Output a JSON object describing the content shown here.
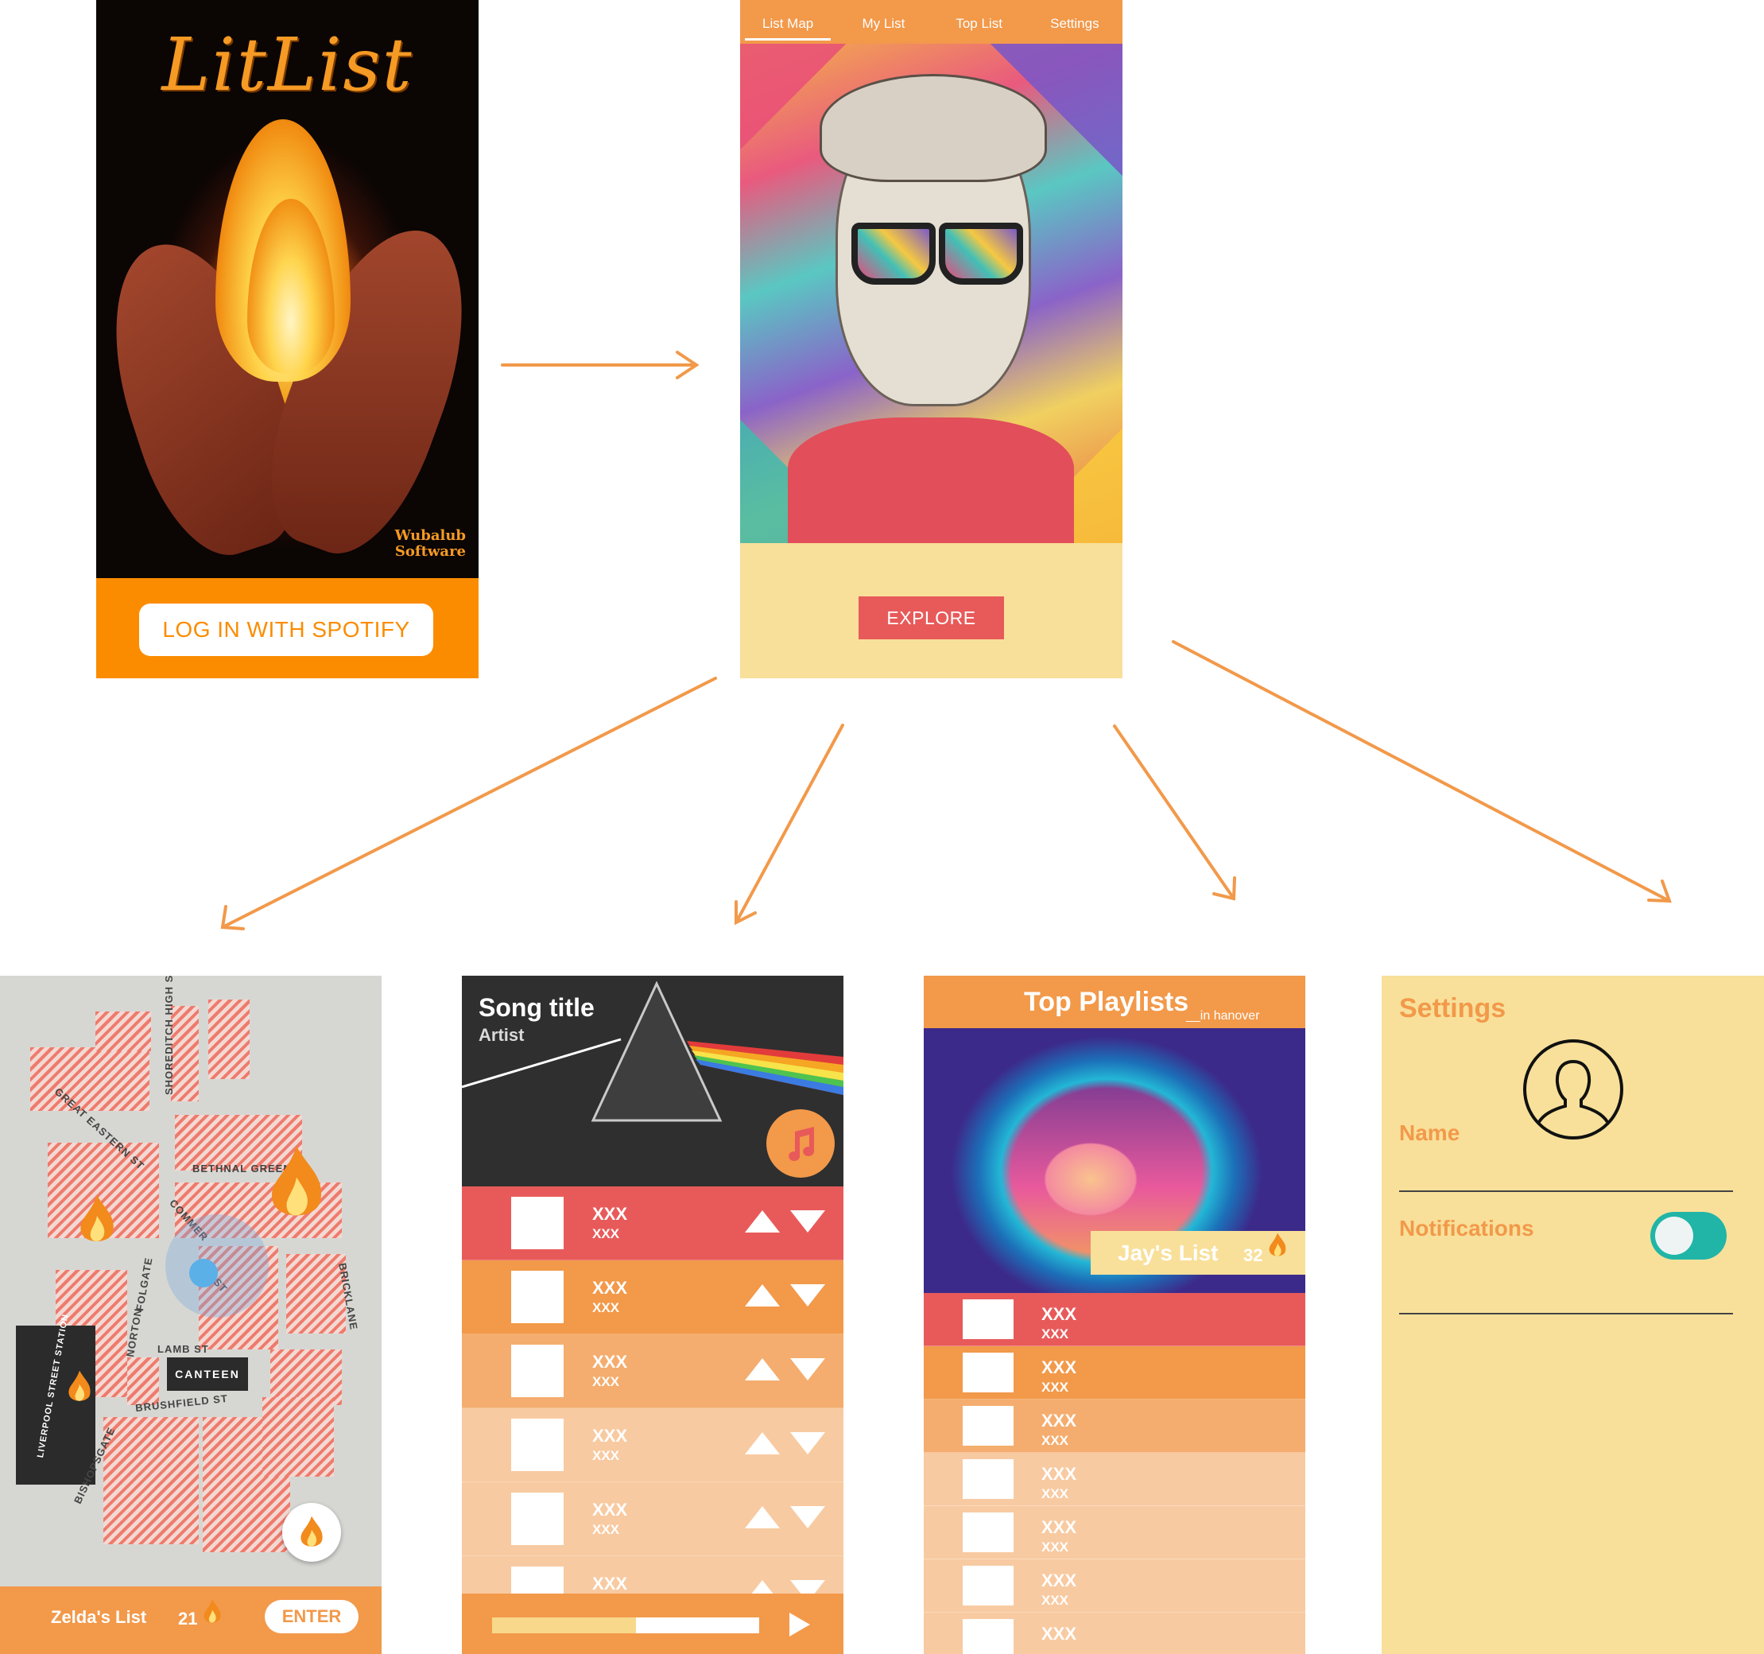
{
  "login": {
    "app_name": "LitList",
    "maker_line1": "Wubalub",
    "maker_line2": "Software",
    "login_button": "LOG IN WITH SPOTIFY"
  },
  "home": {
    "tabs": [
      "List Map",
      "My List",
      "Top List",
      "Settings"
    ],
    "explore_button": "EXPLORE"
  },
  "map": {
    "streets": [
      "SHOREDITCH HIGH ST",
      "GREAT EASTERN ST",
      "BETHNAL GREEN",
      "COMMER",
      "ST",
      "FOLGATE",
      "NORTON",
      "BRICKLANE",
      "LAMB ST",
      "BRUSHFIELD ST",
      "BISHOPSGATE",
      "LIVERPOOL STREET STATION"
    ],
    "canteen_label": "CANTEEN",
    "list_name": "Zelda's List",
    "count": "21",
    "enter_button": "ENTER"
  },
  "mylist": {
    "song_title": "Song title",
    "artist": "Artist",
    "rows": [
      {
        "title": "XXX",
        "sub": "XXX",
        "color": "#e85a5a"
      },
      {
        "title": "XXX",
        "sub": "XXX",
        "color": "#f2994a"
      },
      {
        "title": "XXX",
        "sub": "XXX",
        "color": "#f4ad6e"
      },
      {
        "title": "XXX",
        "sub": "XXX",
        "color": "#f8caa1"
      },
      {
        "title": "XXX",
        "sub": "XXX",
        "color": "#f8caa1"
      },
      {
        "title": "XXX",
        "sub": "",
        "color": "#f8caa1"
      }
    ],
    "progress": 0.54
  },
  "toplist": {
    "title": "Top Playlists",
    "subtitle": "__in hanover",
    "featured_name": "Jay's List",
    "featured_count": "32",
    "rows": [
      {
        "title": "XXX",
        "sub": "XXX",
        "color": "#e85a5a"
      },
      {
        "title": "XXX",
        "sub": "XXX",
        "color": "#f2994a"
      },
      {
        "title": "XXX",
        "sub": "XXX",
        "color": "#f4ad6e"
      },
      {
        "title": "XXX",
        "sub": "XXX",
        "color": "#f8caa1"
      },
      {
        "title": "XXX",
        "sub": "XXX",
        "color": "#f8caa1"
      },
      {
        "title": "XXX",
        "sub": "XXX",
        "color": "#f8caa1"
      },
      {
        "title": "XXX",
        "sub": "",
        "color": "#f8caa1"
      }
    ]
  },
  "settings": {
    "title": "Settings",
    "name_label": "Name",
    "notifications_label": "Notifications",
    "notifications_on": true
  },
  "colors": {
    "accent": "#f2994a",
    "primary_orange": "#fb8c00",
    "red": "#e85a5a",
    "cream": "#f8e09a",
    "teal": "#20b5a7"
  }
}
